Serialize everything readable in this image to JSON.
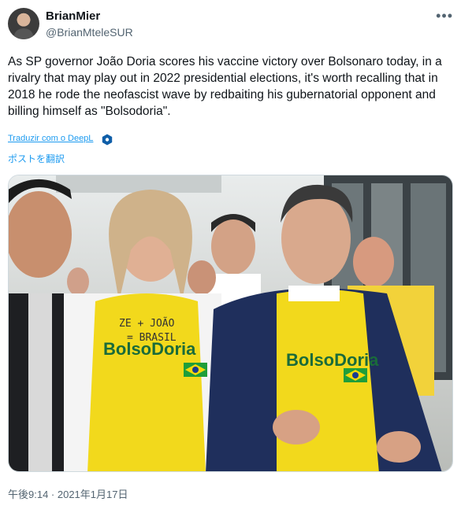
{
  "author": {
    "display_name": "BrianMier",
    "handle": "@BrianMteleSUR",
    "more_icon": "more-icon"
  },
  "tweet": {
    "text": "As SP governor João  Doria scores his vaccine victory over Bolsonaro today, in a rivalry that may play out in 2022 presidential elections, it's worth recalling that in 2018 he rode the neofascist wave by redbaiting his gubernatorial opponent and billing himself as \"Bolsodoria\".",
    "translate_link": "Traduzir com o DeepL",
    "translate_post": "ポストを翻訳",
    "timestamp": "午後9:14 · 2021年1月17日"
  },
  "photo": {
    "shirt_text_left": "BolsoDoria",
    "shirt_text_right": "BolsoDoria",
    "handwriting_top": "ZE + JOÃO",
    "handwriting_mid": "= BRASIL"
  },
  "colors": {
    "link": "#1d9bf0",
    "muted": "#536471",
    "shirt_yellow": "#f2d91c"
  }
}
